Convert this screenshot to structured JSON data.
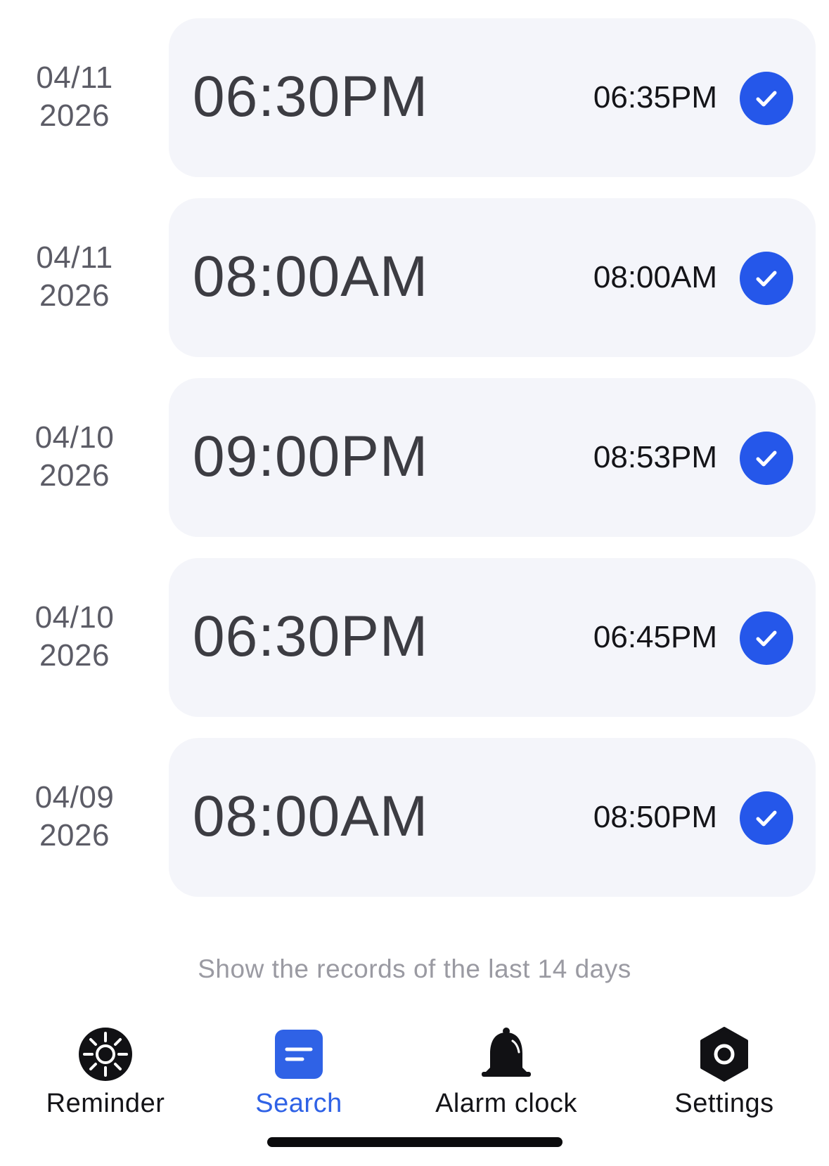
{
  "records": [
    {
      "date": "04/11",
      "year": "2026",
      "scheduled": "06:30PM",
      "actual": "06:35PM"
    },
    {
      "date": "04/11",
      "year": "2026",
      "scheduled": "08:00AM",
      "actual": "08:00AM"
    },
    {
      "date": "04/10",
      "year": "2026",
      "scheduled": "09:00PM",
      "actual": "08:53PM"
    },
    {
      "date": "04/10",
      "year": "2026",
      "scheduled": "06:30PM",
      "actual": "06:45PM"
    },
    {
      "date": "04/09",
      "year": "2026",
      "scheduled": "08:00AM",
      "actual": "08:50PM"
    }
  ],
  "footer_note": "Show the records of the last 14 days",
  "tabs": [
    {
      "label": "Reminder",
      "icon": "sun-icon"
    },
    {
      "label": "Search",
      "icon": "search-list-icon"
    },
    {
      "label": "Alarm clock",
      "icon": "bell-icon"
    },
    {
      "label": "Settings",
      "icon": "hexagon-settings-icon"
    }
  ],
  "active_tab": "Search",
  "colors": {
    "accent": "#2557ea",
    "card_bg": "#f4f5fa",
    "muted_text": "#9a9aa2"
  }
}
